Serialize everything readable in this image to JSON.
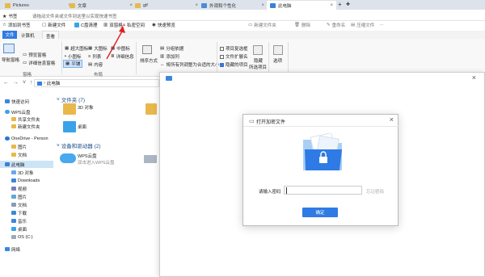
{
  "tabs": [
    {
      "label": "Pictures"
    },
    {
      "label": "文章"
    },
    {
      "label": "gif"
    },
    {
      "label": "外观和个性化"
    },
    {
      "label": "此电脑"
    }
  ],
  "bookmark_bar": {
    "bookmark_label": "书签",
    "hint": "请拖动文件夹或文件到这里以实现快速书签"
  },
  "toolbar": {
    "add_bookmark": "添加到书签",
    "new_file": "新建文件",
    "c_clean": "C盘清理",
    "dual_pane": "双窗格",
    "private_space": "私密空间",
    "quick_preview": "快速预览",
    "new_folder": "新建文件夹",
    "delete": "删除",
    "rename": "重命名",
    "compress": "压缩文件",
    "more": "..."
  },
  "ribbon_tabs": [
    "文件",
    "计算机",
    "查看"
  ],
  "ribbon": {
    "nav_pane": "导航窗格",
    "preview_pane": "预览窗格",
    "details_pane": "详细信息窗格",
    "pane_group": "窗格",
    "xl_icons": "超大图标",
    "l_icons": "大图标",
    "m_icons": "中图标",
    "s_icons": "小图标",
    "list": "列表",
    "details": "详细信息",
    "tiles": "平铺",
    "content": "内容",
    "layout_group": "布局",
    "sort": "排序方式",
    "group_by": "分组依据",
    "add_col": "添加列",
    "fit_cols": "将所有列调整为合适的大小",
    "item_checkbox": "项目复选框",
    "ext": "文件扩展名",
    "hidden": "隐藏的项目",
    "hide_sel": "隐藏",
    "hide_sel2": "所选项目",
    "options": "选项"
  },
  "address": {
    "path": "此电脑"
  },
  "sidebar": [
    {
      "label": "快速访问"
    },
    {
      "label": "WPS云盘"
    },
    {
      "label": "共享文件夹"
    },
    {
      "label": "新建文件夹"
    },
    {
      "label": "OneDrive - Person"
    },
    {
      "label": "图片"
    },
    {
      "label": "文档"
    },
    {
      "label": "此电脑"
    },
    {
      "label": "3D 对象"
    },
    {
      "label": "Downloads"
    },
    {
      "label": "视频"
    },
    {
      "label": "图片"
    },
    {
      "label": "文档"
    },
    {
      "label": "下载"
    },
    {
      "label": "音乐"
    },
    {
      "label": "桌面"
    },
    {
      "label": "OS (C:)"
    },
    {
      "label": "网络"
    }
  ],
  "main": {
    "folders_header": "文件夹 (7)",
    "folder_3d": "3D 对象",
    "folder_desktop": "桌面",
    "devices_header": "设备和驱动器 (2)",
    "wps_title": "WPS云盘",
    "wps_sub": "双击进入WPS云盘"
  },
  "dialog": {
    "title": "打开加密文件",
    "password_label": "请输入密码",
    "password_value": "",
    "forgot": "忘记密码",
    "confirm": "确定"
  }
}
